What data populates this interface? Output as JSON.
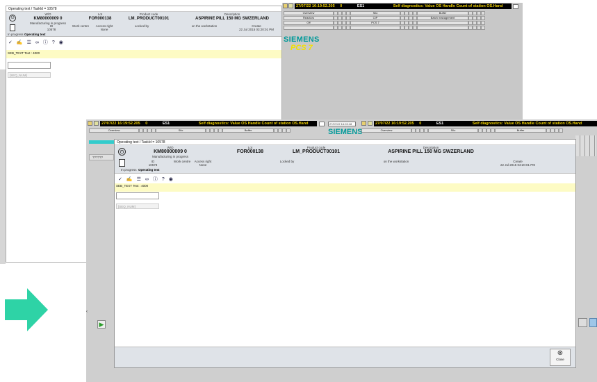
{
  "dialog": {
    "title": "Operating text / TaskId = 10578",
    "wo": {
      "label": "W/O",
      "value": "KM80000009 0",
      "status": "Manufacturing in progress"
    },
    "lot": {
      "label": "Lot",
      "value": "FOR000138"
    },
    "product_code": {
      "label": "Product code",
      "value": "LM_PRODUCT00101"
    },
    "description": {
      "label": "Description",
      "value": "ASPIRINE PILL 150 MG SWZERLAND"
    },
    "id": {
      "label": "ID",
      "value": "10578"
    },
    "work_centre": {
      "label": "Work centre",
      "value": ""
    },
    "access_right": {
      "label": "Access right",
      "value": "None"
    },
    "locked_by": {
      "label": "Locked by",
      "value": ""
    },
    "on_workstation": {
      "label": "on the workstation",
      "value": ""
    },
    "create": {
      "label": "Create",
      "value": "22 Jul 2015 03:20:01 PM"
    },
    "state_text": "In progress",
    "operating_text": "Operating text",
    "toolbar_icons": [
      "check-icon",
      "signature-icon",
      "list-icon",
      "binoculars-icon",
      "info-icon",
      "help-icon",
      "eye-icon"
    ],
    "sb_text": "SEB_TEXT Text : 4000",
    "seq_placeholder": "[SEQ_NUM]",
    "close_label": "Close"
  },
  "bg_dialog_title": "Operating text / TaskId = 10578",
  "mid_window_title": "Operating text / TaskId = 10578",
  "mid_grey_value": "??????",
  "alarm": {
    "date": "27/07/22",
    "time": "16:19:52.205",
    "num": "0",
    "station": "ES1",
    "message": "Self diagnostics: Value OS Handle Count of station OS.Hand"
  },
  "alarm2_stamp": "27/07/22 16:03:18",
  "nav": {
    "rows": [
      [
        "Overview",
        "Silo",
        "Buffer"
      ],
      [
        "Reactors",
        "CIP",
        "Batch management"
      ],
      [
        "Off",
        "PCS 7",
        ""
      ]
    ]
  },
  "brand": {
    "name": "SIEMENS",
    "product": "PCS 7"
  },
  "colors": {
    "arrow": "#2ed3a6",
    "siemens": "#009999",
    "header": "#dfe3e8",
    "note": "#fdfbc4"
  }
}
